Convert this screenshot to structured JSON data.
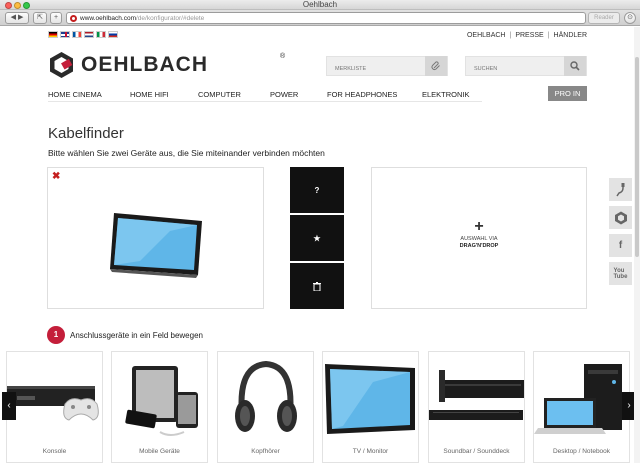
{
  "browser": {
    "title": "Oehlbach",
    "url_host": "www.oehlbach.com",
    "url_path": "/de/konfigurator/#delete",
    "reader_label": "Reader"
  },
  "topbar": {
    "languages": [
      "de",
      "en",
      "fr",
      "nl",
      "it",
      "ru"
    ],
    "links": [
      "OEHLBACH",
      "PRESSE",
      "HÄNDLER"
    ]
  },
  "logo": {
    "text": "OEHLBACH",
    "reg": "®"
  },
  "merkliste": {
    "placeholder": "MERKLISTE"
  },
  "search": {
    "placeholder": "SUCHEN"
  },
  "nav": {
    "items": [
      "HOME CINEMA",
      "HOME HIFI",
      "COMPUTER",
      "POWER",
      "FOR HEADPHONES",
      "ELEKTRONIK"
    ],
    "pro_label": "PRO IN"
  },
  "finder": {
    "title": "Kabelfinder",
    "subtitle": "Bitte wählen Sie zwei Geräte aus, die Sie miteinander verbinden möchten",
    "remove_label": "✖",
    "actions": {
      "help": "?",
      "favorite": "★",
      "delete": "🗑"
    },
    "drop": {
      "plus": "+",
      "line1": "AUSWAHL VIA",
      "line2": "DRAG'N'DROP"
    }
  },
  "step": {
    "number": "1",
    "text": "Anschlussgeräte in ein Feld bewegen"
  },
  "carousel": {
    "items": [
      "Konsole",
      "Mobile Geräte",
      "Kopfhörer",
      "TV / Monitor",
      "Soundbar / Sounddeck",
      "Desktop / Notebook"
    ]
  },
  "colors": {
    "brand_red": "#c41e3a",
    "dark": "#111111"
  }
}
